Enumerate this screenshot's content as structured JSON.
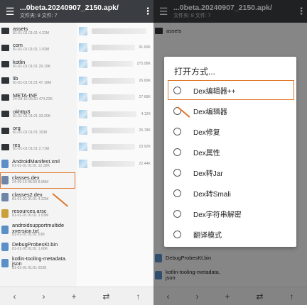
{
  "left": {
    "title": "...0beta.20240907_2150.apk/",
    "subtitle": "文件夹: 8  文件: 7",
    "items": [
      {
        "name": "assets",
        "meta": "81-01-01 01:01  4.22M",
        "kind": "folder"
      },
      {
        "name": "com",
        "meta": "81-01-01 01:01  1.92M",
        "kind": "folder"
      },
      {
        "name": "kotlin",
        "meta": "81-01-01 01:01  29.19K",
        "kind": "folder"
      },
      {
        "name": "lib",
        "meta": "81-01-01 01:01  47.18M",
        "kind": "folder"
      },
      {
        "name": "META-INF",
        "meta": "24-09-16 05:50  474.22K",
        "kind": "folder"
      },
      {
        "name": "okhttp3",
        "meta": "81-01-01 01:01  33.20K",
        "kind": "folder"
      },
      {
        "name": "org",
        "meta": "81-01-01 01:01  1638",
        "kind": "folder"
      },
      {
        "name": "res",
        "meta": "81-01-01 01:01  2.71M",
        "kind": "folder"
      },
      {
        "name": "AndroidManifest.xml",
        "meta": "81-01-01 01:01  12.38K",
        "kind": "file"
      },
      {
        "name": "classes.dex",
        "meta": "24-09-16 05:50  8.85M",
        "kind": "dex"
      },
      {
        "name": "classes2.dex",
        "meta": "81-01-01 01:01  4.22M",
        "kind": "dex"
      },
      {
        "name": "resources.arsc",
        "meta": "81-01-01 01:01  1.53M",
        "kind": "zip"
      },
      {
        "name": "androidsupportmultide xversion.txt",
        "meta": "81-01-01 01:01  53B",
        "kind": "file"
      },
      {
        "name": "DebugProbesKt.bin",
        "meta": "81-01-01 01:01  1.66K",
        "kind": "file"
      },
      {
        "name": "kotlin-tooling-metadata. json",
        "meta": "81-01-01 01:01  6238",
        "kind": "file"
      }
    ],
    "right_sizes": [
      "",
      "91.69K",
      "275.98K",
      "26.69K",
      "27.68K",
      "4.12K",
      "25.78K",
      "23.92K",
      "22.44K"
    ]
  },
  "right": {
    "title": "...0beta.20240907_2150.apk/",
    "subtitle": "文件夹: 8  文件: 7",
    "dialog_title": "打开方式...",
    "options": [
      "Dex编辑器++",
      "Dex编辑器",
      "Dex修复",
      "Dex属性",
      "Dex转Jar",
      "Dex转Smali",
      "Dex字符串解密",
      "翻译模式"
    ],
    "bg_items": [
      "assets",
      "DebugProbesKt.bin",
      "kotlin-tooling-metadata. json"
    ]
  },
  "bottombar": {
    "back": "‹",
    "fwd": "›",
    "add": "+",
    "swap": "⇄",
    "up": "↑"
  },
  "colors": {
    "accent": "#e0772b",
    "appbar": "#3a3d41"
  }
}
